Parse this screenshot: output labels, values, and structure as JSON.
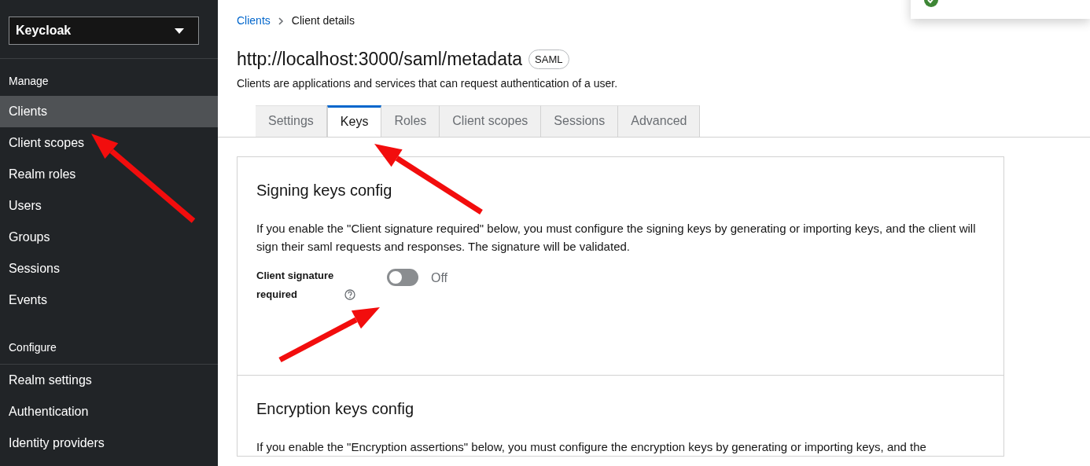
{
  "sidebar": {
    "realm_select": {
      "value": "Keycloak"
    },
    "sections": [
      {
        "heading": "Manage",
        "items": [
          {
            "label": "Clients",
            "selected": true
          },
          {
            "label": "Client scopes",
            "selected": false
          },
          {
            "label": "Realm roles",
            "selected": false
          },
          {
            "label": "Users",
            "selected": false
          },
          {
            "label": "Groups",
            "selected": false
          },
          {
            "label": "Sessions",
            "selected": false
          },
          {
            "label": "Events",
            "selected": false
          }
        ]
      },
      {
        "heading": "Configure",
        "items": [
          {
            "label": "Realm settings",
            "selected": false
          },
          {
            "label": "Authentication",
            "selected": false
          },
          {
            "label": "Identity providers",
            "selected": false
          }
        ]
      }
    ]
  },
  "breadcrumb": [
    "Clients",
    "Client details"
  ],
  "title": "http://localhost:3000/saml/metadata",
  "badge": "SAML",
  "description": "Clients are applications and services that can request authentication of a user.",
  "tabs": [
    {
      "label": "Settings",
      "selected": false
    },
    {
      "label": "Keys",
      "selected": true
    },
    {
      "label": "Roles",
      "selected": false
    },
    {
      "label": "Client scopes",
      "selected": false
    },
    {
      "label": "Sessions",
      "selected": false
    },
    {
      "label": "Advanced",
      "selected": false
    }
  ],
  "sections": [
    {
      "title": "Signing keys config",
      "text": "If you enable the \"Client signature required\" below, you must configure the signing keys by generating or importing keys, and the client will sign their saml requests and responses. The signature will be validated.",
      "switch": {
        "label": "Client signature required",
        "on": false,
        "state_text": "Off"
      }
    },
    {
      "title": "Encryption keys config",
      "text": "If you enable the \"Encryption assertions\" below, you must configure the encryption keys by generating or importing keys, and the"
    }
  ]
}
